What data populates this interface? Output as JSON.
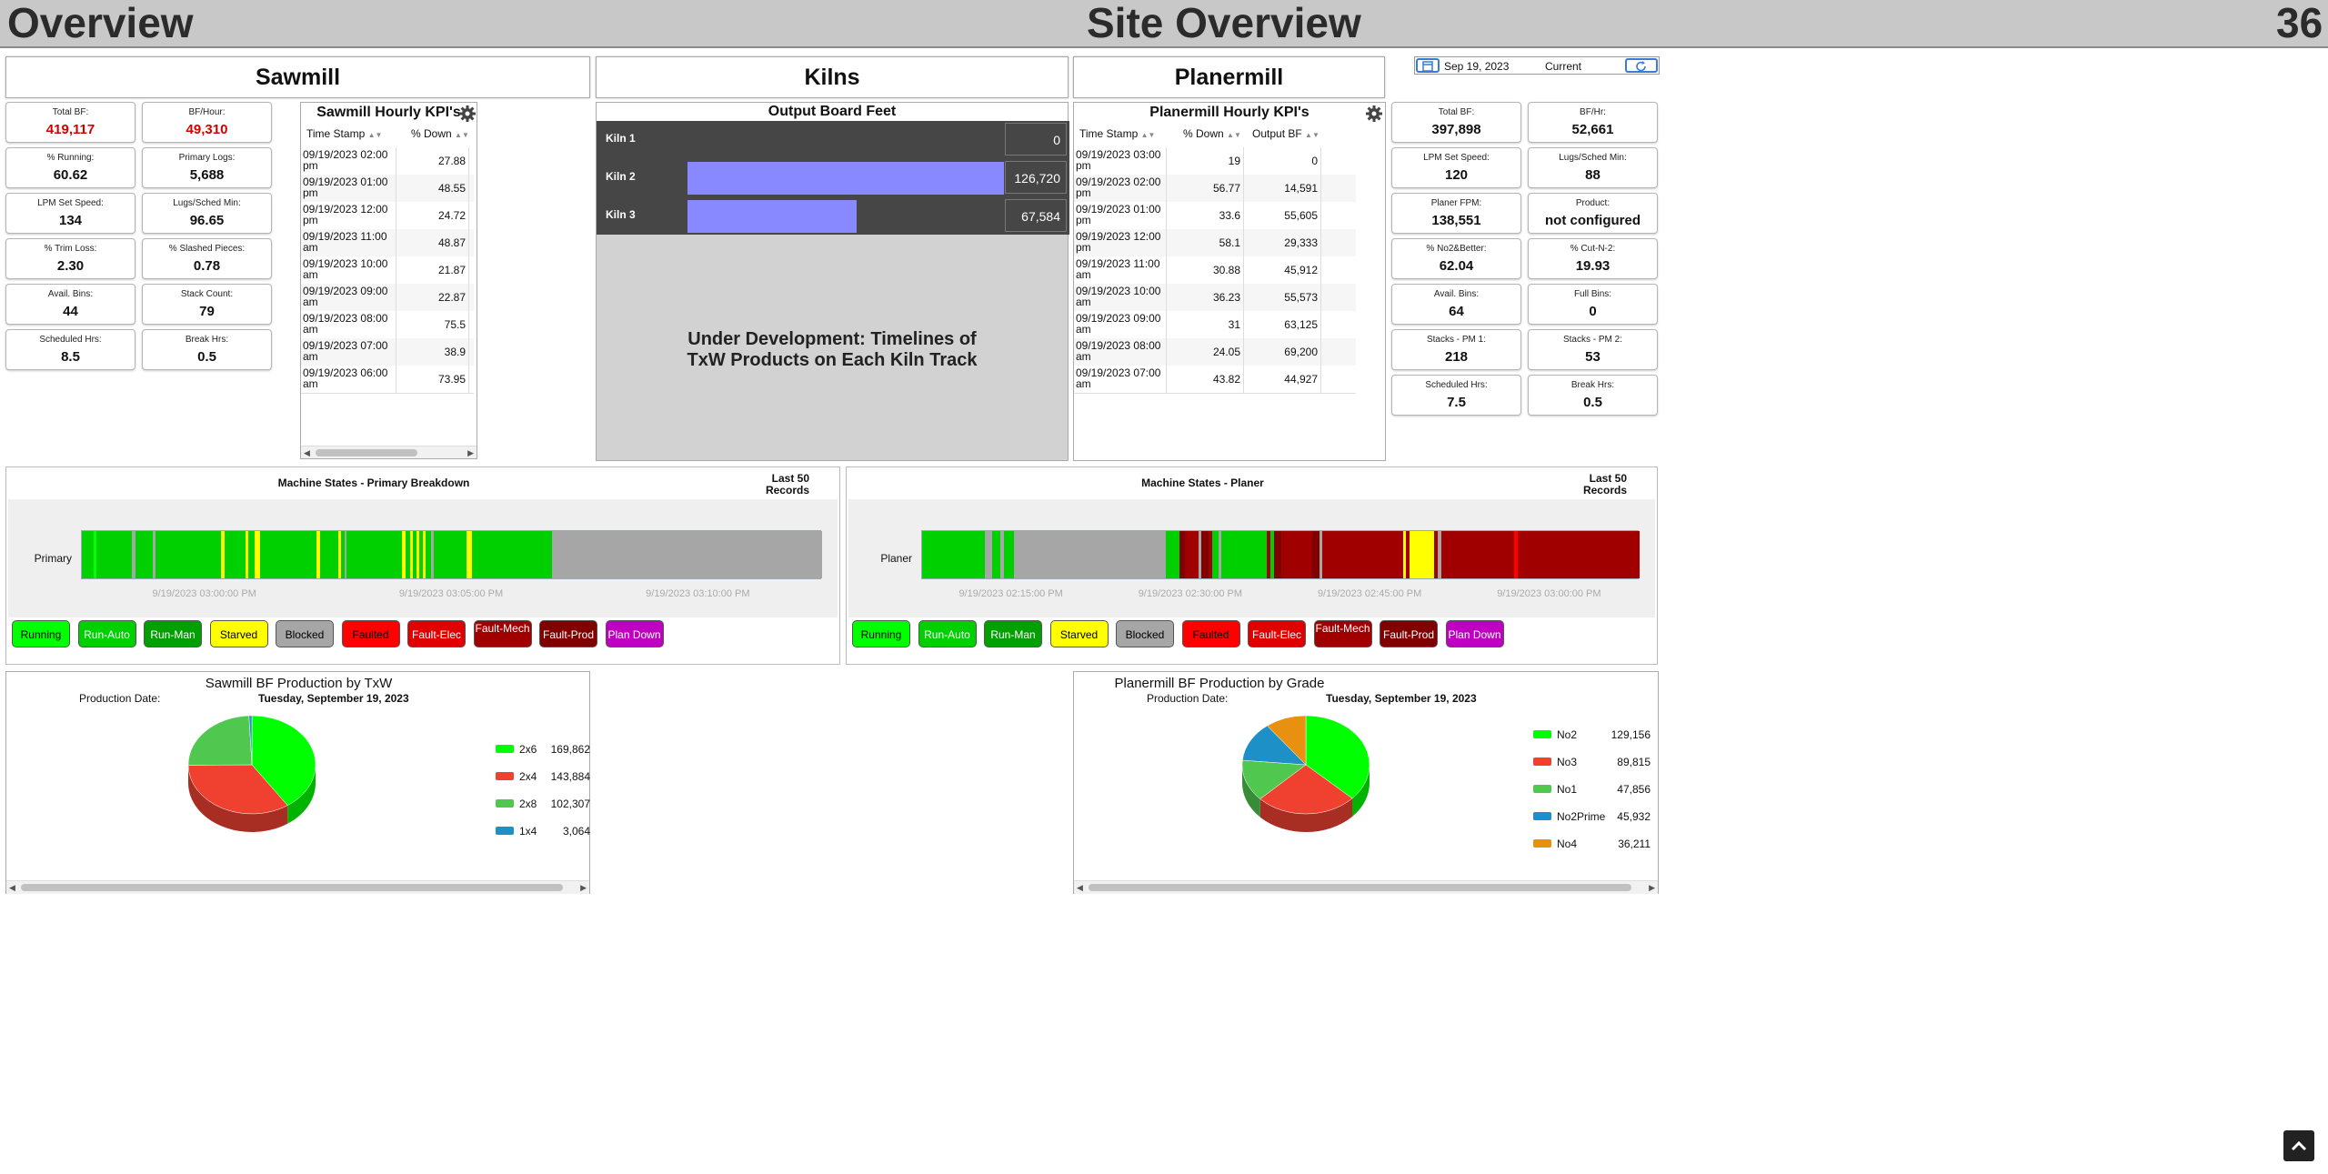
{
  "header": {
    "left": "Overview",
    "center": "Site Overview",
    "right": "36"
  },
  "sections": {
    "sawmill": "Sawmill",
    "kilns": "Kilns",
    "planermill": "Planermill"
  },
  "date_picker": {
    "date": "Sep 19, 2023",
    "mode": "Current"
  },
  "sawmill_kpis": [
    {
      "label": "Total BF:",
      "value": "419,117",
      "highlight": true
    },
    {
      "label": "BF/Hour:",
      "value": "49,310",
      "highlight": true
    },
    {
      "label": "% Running:",
      "value": "60.62"
    },
    {
      "label": "Primary Logs:",
      "value": "5,688"
    },
    {
      "label": "LPM Set Speed:",
      "value": "134"
    },
    {
      "label": "Lugs/Sched Min:",
      "value": "96.65"
    },
    {
      "label": "% Trim Loss:",
      "value": "2.30"
    },
    {
      "label": "% Slashed Pieces:",
      "value": "0.78"
    },
    {
      "label": "Avail. Bins:",
      "value": "44"
    },
    {
      "label": "Stack Count:",
      "value": "79"
    },
    {
      "label": "Scheduled Hrs:",
      "value": "8.5"
    },
    {
      "label": "Break Hrs:",
      "value": "0.5"
    }
  ],
  "sawmill_hourly": {
    "title": "Sawmill Hourly KPI's",
    "columns": [
      "Time Stamp",
      "% Down"
    ],
    "rows": [
      {
        "ts1": "09/19/2023 02:00",
        "ts2": "pm",
        "down": "27.88"
      },
      {
        "ts1": "09/19/2023 01:00",
        "ts2": "pm",
        "down": "48.55"
      },
      {
        "ts1": "09/19/2023 12:00",
        "ts2": "pm",
        "down": "24.72"
      },
      {
        "ts1": "09/19/2023 11:00",
        "ts2": "am",
        "down": "48.87"
      },
      {
        "ts1": "09/19/2023 10:00",
        "ts2": "am",
        "down": "21.87"
      },
      {
        "ts1": "09/19/2023 09:00",
        "ts2": "am",
        "down": "22.87"
      },
      {
        "ts1": "09/19/2023 08:00",
        "ts2": "am",
        "down": "75.5"
      },
      {
        "ts1": "09/19/2023 07:00",
        "ts2": "am",
        "down": "38.9"
      },
      {
        "ts1": "09/19/2023 06:00",
        "ts2": "am",
        "down": "73.95"
      }
    ]
  },
  "kilns": {
    "title": "Output Board Feet",
    "max": 126720,
    "rows": [
      {
        "name": "Kiln 1",
        "value": "0",
        "amount": 0
      },
      {
        "name": "Kiln 2",
        "value": "126,720",
        "amount": 126720
      },
      {
        "name": "Kiln 3",
        "value": "67,584",
        "amount": 67584
      }
    ],
    "dev_text": "Under Development: Timelines of TxW Products on Each Kiln Track"
  },
  "planer_hourly": {
    "title": "Planermill Hourly KPI's",
    "columns": [
      "Time Stamp",
      "% Down",
      "Output BF"
    ],
    "rows": [
      {
        "ts1": "09/19/2023 03:00",
        "ts2": "pm",
        "down": "19",
        "bf": "0"
      },
      {
        "ts1": "09/19/2023 02:00",
        "ts2": "pm",
        "down": "56.77",
        "bf": "14,591"
      },
      {
        "ts1": "09/19/2023 01:00",
        "ts2": "pm",
        "down": "33.6",
        "bf": "55,605"
      },
      {
        "ts1": "09/19/2023 12:00",
        "ts2": "pm",
        "down": "58.1",
        "bf": "29,333"
      },
      {
        "ts1": "09/19/2023 11:00",
        "ts2": "am",
        "down": "30.88",
        "bf": "45,912"
      },
      {
        "ts1": "09/19/2023 10:00",
        "ts2": "am",
        "down": "36.23",
        "bf": "55,573"
      },
      {
        "ts1": "09/19/2023 09:00",
        "ts2": "am",
        "down": "31",
        "bf": "63,125"
      },
      {
        "ts1": "09/19/2023 08:00",
        "ts2": "am",
        "down": "24.05",
        "bf": "69,200"
      },
      {
        "ts1": "09/19/2023 07:00",
        "ts2": "am",
        "down": "43.82",
        "bf": "44,927"
      }
    ]
  },
  "planer_kpis": [
    {
      "label": "Total BF:",
      "value": "397,898"
    },
    {
      "label": "BF/Hr:",
      "value": "52,661"
    },
    {
      "label": "LPM Set Speed:",
      "value": "120"
    },
    {
      "label": "Lugs/Sched Min:",
      "value": "88"
    },
    {
      "label": "Planer FPM:",
      "value": "138,551"
    },
    {
      "label": "Product:",
      "value": "not configured"
    },
    {
      "label": "% No2&Better:",
      "value": "62.04"
    },
    {
      "label": "% Cut-N-2:",
      "value": "19.93"
    },
    {
      "label": "Avail. Bins:",
      "value": "64"
    },
    {
      "label": "Full Bins:",
      "value": "0"
    },
    {
      "label": "Stacks - PM 1:",
      "value": "218"
    },
    {
      "label": "Stacks - PM 2:",
      "value": "53"
    },
    {
      "label": "Scheduled Hrs:",
      "value": "7.5"
    },
    {
      "label": "Break Hrs:",
      "value": "0.5"
    }
  ],
  "state_colors": {
    "Running": "#00ff00",
    "Run-Auto": "#00d000",
    "Run-Man": "#00a000",
    "Starved": "#ffff00",
    "Blocked": "#a6a6a6",
    "Faulted": "#ff0000",
    "Fault-Elec": "#e00000",
    "Fault-Mech": "#a00000",
    "Fault-Prod": "#800000",
    "Plan Down": "#c000c0"
  },
  "legend": [
    {
      "label": "Running",
      "bg": "#00ff00",
      "fg": "#000"
    },
    {
      "label": "Run-Auto",
      "bg": "#00d000",
      "fg": "#fff"
    },
    {
      "label": "Run-Man",
      "bg": "#00a000",
      "fg": "#fff"
    },
    {
      "label": "Starved",
      "bg": "#ffff00",
      "fg": "#000"
    },
    {
      "label": "Blocked",
      "bg": "#a6a6a6",
      "fg": "#000"
    },
    {
      "label": "Faulted",
      "bg": "#ff0000",
      "fg": "#000"
    },
    {
      "label": "Fault-Elec",
      "bg": "#e00000",
      "fg": "#fff"
    },
    {
      "label": "Fault-Mech",
      "bg": "#a00000",
      "fg": "#fff"
    },
    {
      "label": "Fault-Prod",
      "bg": "#800000",
      "fg": "#fff"
    },
    {
      "label": "Plan Down",
      "bg": "#c000c0",
      "fg": "#fff"
    }
  ],
  "machine_states": [
    {
      "title": "Machine States - Primary Breakdown",
      "records": "Last 50 Records",
      "machine": "Primary",
      "ticks": [
        "9/19/2023 03:00:00 PM",
        "9/19/2023 03:05:00 PM",
        "9/19/2023 03:10:00 PM"
      ],
      "segments": [
        [
          "Run-Auto",
          2
        ],
        [
          "Running",
          0.5
        ],
        [
          "Run-Auto",
          6
        ],
        [
          "Blocked",
          0.5
        ],
        [
          "Run-Auto",
          3
        ],
        [
          "Blocked",
          0.4
        ],
        [
          "Run-Auto",
          11
        ],
        [
          "Starved",
          0.7
        ],
        [
          "Run-Auto",
          3.5
        ],
        [
          "Starved",
          0.5
        ],
        [
          "Run-Auto",
          1
        ],
        [
          "Starved",
          1
        ],
        [
          "Run-Auto",
          9.5
        ],
        [
          "Starved",
          0.6
        ],
        [
          "Run-Auto",
          3
        ],
        [
          "Starved",
          0.6
        ],
        [
          "Run-Auto",
          0.5
        ],
        [
          "Blocked",
          0.4
        ],
        [
          "Run-Auto",
          9.3
        ],
        [
          "Starved",
          0.6
        ],
        [
          "Run-Auto",
          0.8
        ],
        [
          "Starved",
          0.5
        ],
        [
          "Run-Auto",
          0.5
        ],
        [
          "Starved",
          0.6
        ],
        [
          "Run-Auto",
          0.5
        ],
        [
          "Starved",
          0.5
        ],
        [
          "Run-Auto",
          0.9
        ],
        [
          "Blocked",
          0.5
        ],
        [
          "Run-Auto",
          5.5
        ],
        [
          "Starved",
          1
        ],
        [
          "Run-Auto",
          13.5
        ],
        [
          "Blocked",
          45.5
        ]
      ]
    },
    {
      "title": "Machine States - Planer",
      "records": "Last 50 Records",
      "machine": "Planer",
      "ticks": [
        "9/19/2023 02:15:00 PM",
        "9/19/2023 02:30:00 PM",
        "9/19/2023 02:45:00 PM",
        "9/19/2023 03:00:00 PM"
      ],
      "segments": [
        [
          "Run-Auto",
          9
        ],
        [
          "Blocked",
          1
        ],
        [
          "Run-Auto",
          1.2
        ],
        [
          "Blocked",
          0.5
        ],
        [
          "Run-Auto",
          1.5
        ],
        [
          "Blocked",
          1.3
        ],
        [
          "Blocked",
          20.5
        ],
        [
          "Run-Auto",
          2
        ],
        [
          "Fault-Prod",
          0.7
        ],
        [
          "Fault-Mech",
          2
        ],
        [
          "Blocked",
          0.4
        ],
        [
          "Fault-Prod",
          1
        ],
        [
          "Fault-Mech",
          0.5
        ],
        [
          "Run-Auto",
          1
        ],
        [
          "Blocked",
          0.4
        ],
        [
          "Run-Auto",
          6.5
        ],
        [
          "Fault-Mech",
          0.5
        ],
        [
          "Run-Auto",
          0.5
        ],
        [
          "Fault-Prod",
          1
        ],
        [
          "Fault-Mech",
          4.5
        ],
        [
          "Fault-Prod",
          1
        ],
        [
          "Blocked",
          0.5
        ],
        [
          "Fault-Mech",
          11.5
        ],
        [
          "Starved",
          0.5
        ],
        [
          "Fault-Mech",
          0.5
        ],
        [
          "Starved",
          3.5
        ],
        [
          "Fault-Mech",
          0.5
        ],
        [
          "Blocked",
          0.5
        ],
        [
          "Fault-Mech",
          10.5
        ],
        [
          "Faulted",
          0.5
        ],
        [
          "Fault-Mech",
          17.5
        ]
      ]
    }
  ],
  "pie_sawmill": {
    "title": "Sawmill BF Production by TxW",
    "date_label": "Production Date:",
    "date_value": "Tuesday, September 19, 2023",
    "slices": [
      {
        "label": "2x6",
        "value": "169,862",
        "amount": 169862,
        "color": "#00ff00"
      },
      {
        "label": "2x4",
        "value": "143,884",
        "amount": 143884,
        "color": "#f04030"
      },
      {
        "label": "2x8",
        "value": "102,307",
        "amount": 102307,
        "color": "#50c850"
      },
      {
        "label": "1x4",
        "value": "3,064",
        "amount": 3064,
        "color": "#1e90c8"
      }
    ]
  },
  "pie_planer": {
    "title": "Planermill BF Production by Grade",
    "date_label": "Production Date:",
    "date_value": "Tuesday, September 19, 2023",
    "slices": [
      {
        "label": "No2",
        "value": "129,156",
        "amount": 129156,
        "color": "#00ff00"
      },
      {
        "label": "No3",
        "value": "89,815",
        "amount": 89815,
        "color": "#f04030"
      },
      {
        "label": "No1",
        "value": "47,856",
        "amount": 47856,
        "color": "#50c850"
      },
      {
        "label": "No2Prime",
        "value": "45,932",
        "amount": 45932,
        "color": "#1e90c8"
      },
      {
        "label": "No4",
        "value": "36,211",
        "amount": 36211,
        "color": "#e89010"
      }
    ]
  }
}
